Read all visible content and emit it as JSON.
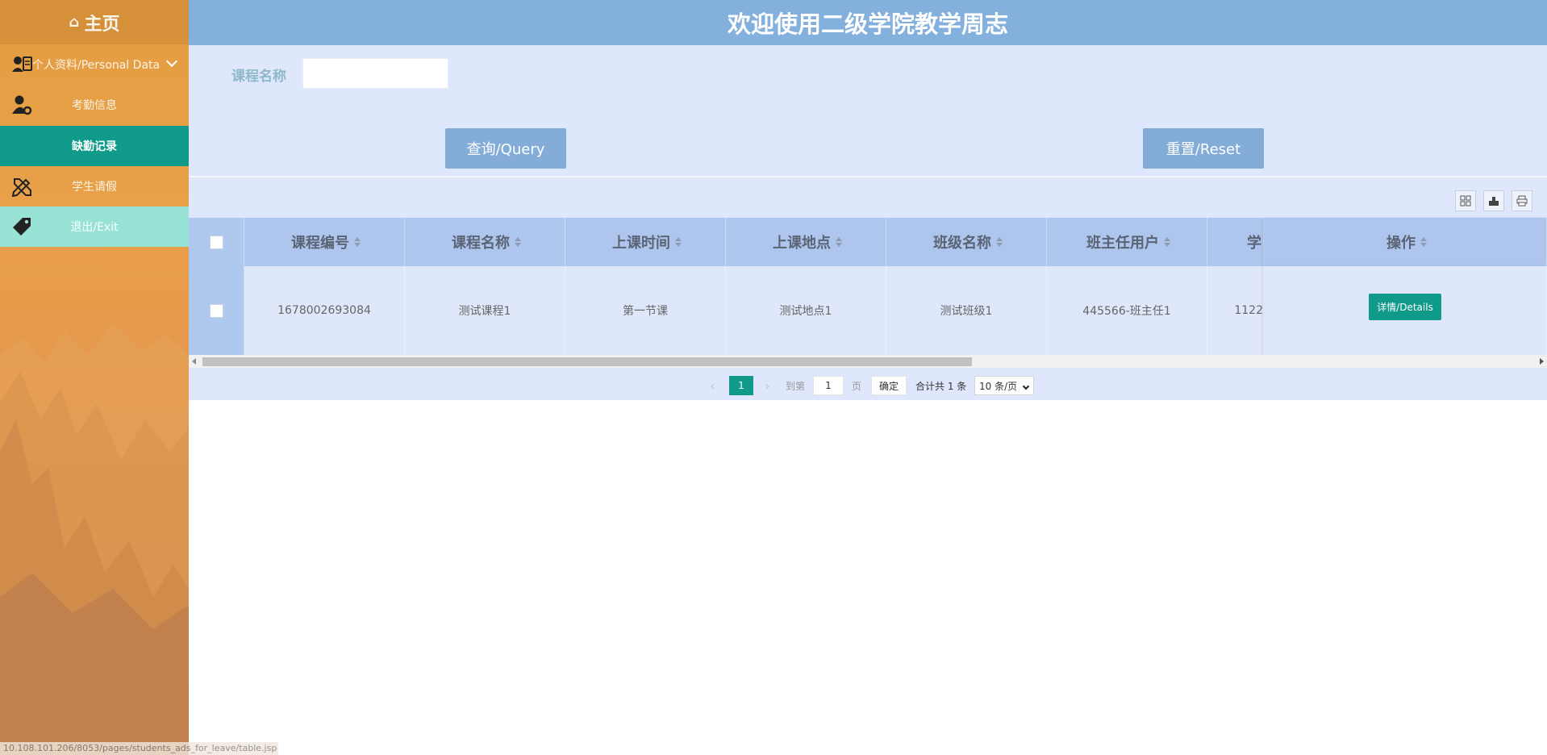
{
  "header": {
    "title": "欢迎使用二级学院教学周志"
  },
  "sidebar": {
    "home_label": "主页",
    "items": [
      {
        "label": "个人资料/Personal Data",
        "icon": "user-card-icon"
      },
      {
        "label": "考勤信息",
        "icon": "user-gear-icon"
      },
      {
        "label": "缺勤记录",
        "icon": ""
      },
      {
        "label": "学生请假",
        "icon": "pen-ruler-icon"
      },
      {
        "label": "退出/Exit",
        "icon": "tag-icon"
      }
    ],
    "active_color": "#0f9a8a"
  },
  "search": {
    "label": "课程名称",
    "value": "",
    "query_label": "查询/Query",
    "reset_label": "重置/Reset"
  },
  "toolbar": {
    "icons": [
      "columns-icon",
      "export-icon",
      "print-icon"
    ]
  },
  "table": {
    "columns": [
      "课程编号",
      "课程名称",
      "上课时间",
      "上课地点",
      "班级名称",
      "班主任用户",
      "学",
      "操作"
    ],
    "rows": [
      {
        "course_id": "1678002693084",
        "course_name": "测试课程1",
        "time": "第一节课",
        "place": "测试地点1",
        "class_name": "测试班级1",
        "teacher": "445566-班主任1",
        "partial": "1122",
        "action_label": "详情/Details"
      }
    ]
  },
  "pager": {
    "current_page": "1",
    "goto_label": "到第",
    "goto_value": "1",
    "page_unit": "页",
    "confirm_label": "确定",
    "total_text": "合计共 1 条",
    "page_size": "10 条/页"
  },
  "statusbar": {
    "url": "10.108.101.206/8053/pages/students_ads_for_leave/table.jsp"
  }
}
